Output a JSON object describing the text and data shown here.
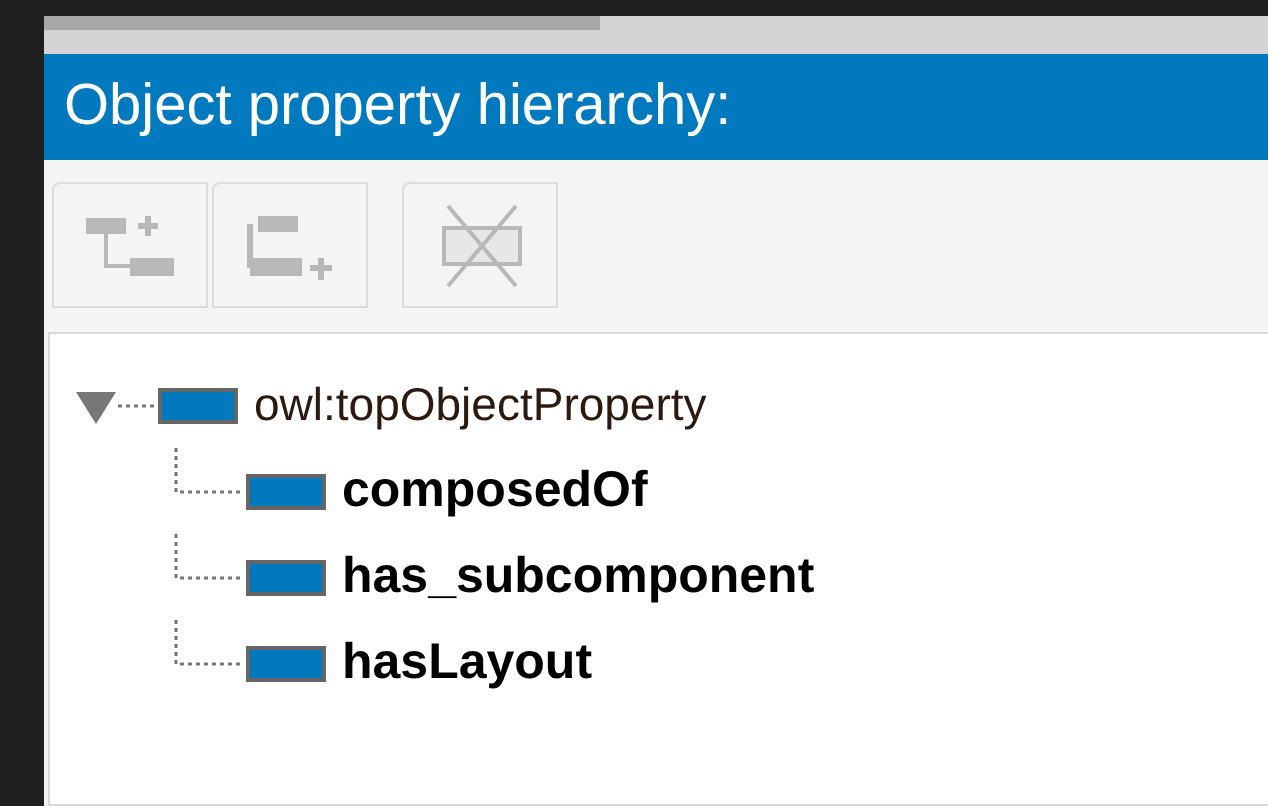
{
  "panel": {
    "title": "Object property hierarchy:"
  },
  "toolbar": [
    {
      "kind": "add-sub",
      "disabled": true
    },
    {
      "kind": "add-sibling",
      "disabled": true
    },
    {
      "kind": "delete",
      "disabled": true
    }
  ],
  "tree": [
    {
      "label": "owl:topObjectProperty",
      "expanded": true,
      "children": [
        {
          "label": "composedOf"
        },
        {
          "label": "has_subcomponent"
        },
        {
          "label": "hasLayout"
        }
      ]
    }
  ]
}
